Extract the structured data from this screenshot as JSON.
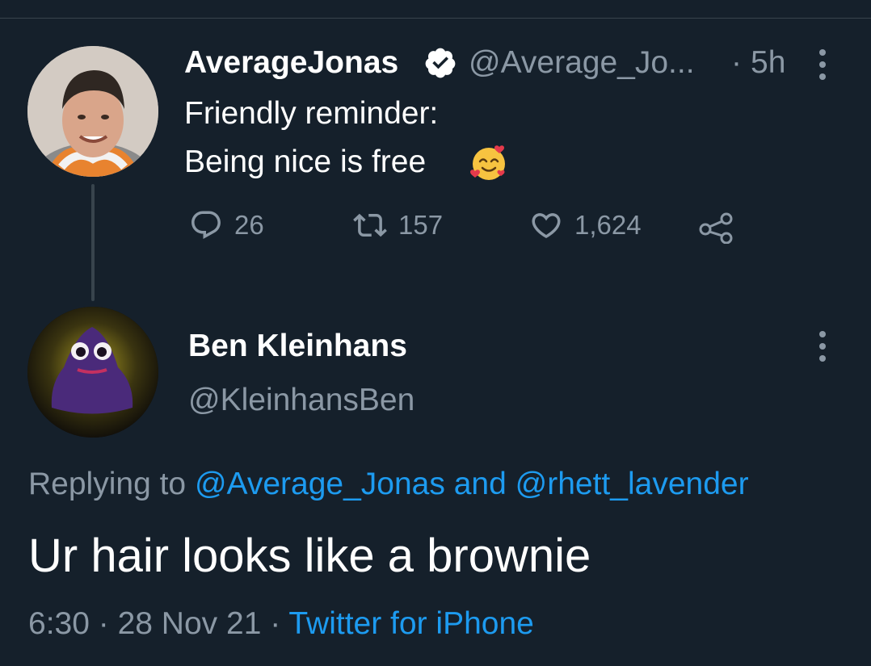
{
  "colors": {
    "background": "#15202b",
    "text_primary": "#ffffff",
    "text_secondary": "#8b98a5",
    "link": "#1d9bf0",
    "divider": "#38444d",
    "verified_badge": "#ffffff"
  },
  "original_tweet": {
    "display_name": "AverageJonas",
    "verified_icon": "verified-badge-icon",
    "handle": "@Average_Jo...",
    "separator": "·",
    "time": "5h",
    "more_icon": "more-vertical-icon",
    "text_lines": [
      "Friendly reminder:",
      "Being nice is free"
    ],
    "emoji_icon": "smiling-face-with-hearts-emoji",
    "actions": {
      "reply": {
        "icon": "reply-icon",
        "count": "26"
      },
      "retweet": {
        "icon": "retweet-icon",
        "count": "157"
      },
      "like": {
        "icon": "heart-icon",
        "count": "1,624"
      },
      "share": {
        "icon": "share-icon"
      }
    }
  },
  "reply_tweet": {
    "display_name": "Ben Kleinhans",
    "handle": "@KleinhansBen",
    "more_icon": "more-vertical-icon",
    "replying_prefix": "Replying to",
    "replying_user_1": "@Average_Jonas",
    "replying_and": "and",
    "replying_user_2": "@rhett_lavender",
    "text": "Ur hair looks like a brownie",
    "time": "6:30",
    "separator": "·",
    "date": "28 Nov 21",
    "source": "Twitter for iPhone"
  }
}
